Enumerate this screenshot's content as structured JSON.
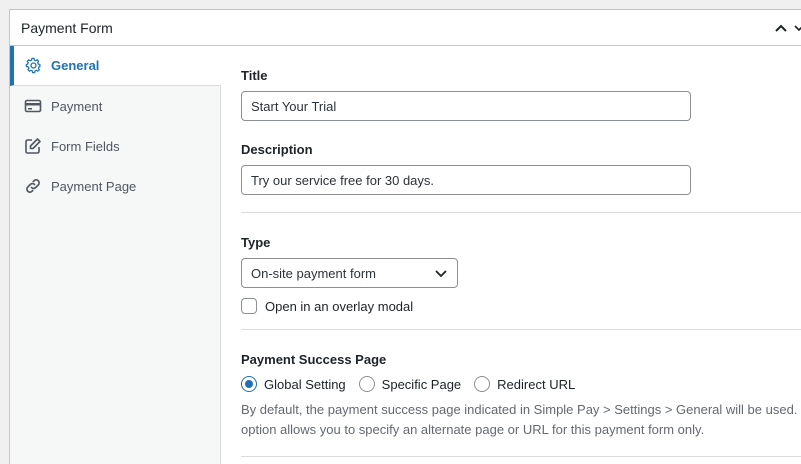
{
  "postbox": {
    "title": "Payment Form"
  },
  "tabs": [
    {
      "label": "General",
      "icon": "gear-icon",
      "active": true
    },
    {
      "label": "Payment",
      "icon": "credit-card-icon",
      "active": false
    },
    {
      "label": "Form Fields",
      "icon": "edit-icon",
      "active": false
    },
    {
      "label": "Payment Page",
      "icon": "link-icon",
      "active": false
    }
  ],
  "general": {
    "title_label": "Title",
    "title_value": "Start Your Trial",
    "description_label": "Description",
    "description_value": "Try our service free for 30 days.",
    "type_label": "Type",
    "type_selected": "On-site payment form",
    "overlay_label": "Open in an overlay modal",
    "overlay_checked": false,
    "success_label": "Payment Success Page",
    "success_options": [
      "Global Setting",
      "Specific Page",
      "Redirect URL"
    ],
    "success_selected": "Global Setting",
    "success_desc_line1": "By default, the payment success page indicated in Simple Pay > Settings > General will be used. This",
    "success_desc_line2": "option allows you to specify an alternate page or URL for this payment form only."
  },
  "colors": {
    "accent": "#2271b1",
    "background": "#f0f0f1",
    "border": "#c3c4c7"
  }
}
